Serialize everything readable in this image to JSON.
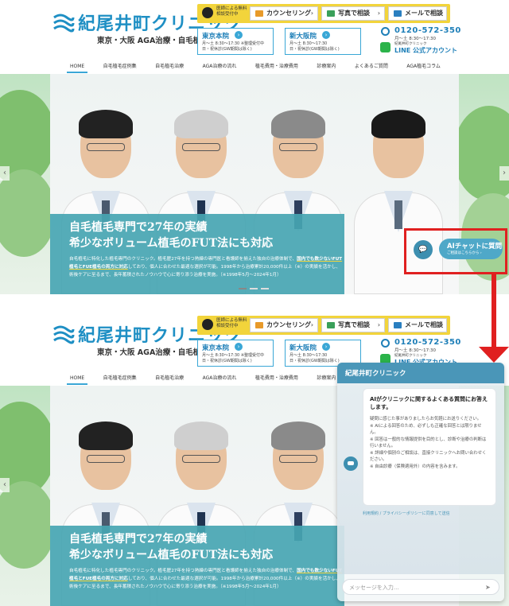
{
  "header": {
    "brand_name": "紀尾井町クリニック",
    "brand_sub": "東京・大阪 AGA治療・自毛植毛",
    "contact_note": "医師による無料相談受付中",
    "buttons": [
      {
        "label": "カウンセリング",
        "color": "#e89a2a"
      },
      {
        "label": "写真で相談",
        "color": "#3aa05a"
      },
      {
        "label": "メールで相談",
        "color": "#2a7fc0"
      }
    ],
    "clinics": [
      {
        "name": "東京本院",
        "hours": "月〜土 8:30〜17:30 ※整理受付中",
        "holiday": "日・祝休診(GW期間は除く)"
      },
      {
        "name": "新大阪院",
        "hours": "月〜土 8:30〜17:30",
        "holiday": "日・祝休診(GW期間は除く)"
      }
    ],
    "tel": "0120-572-350",
    "tel_hours": "月〜土 8:30〜17:30",
    "line_sub": "紀尾井町クリニック",
    "line_label": "LINE 公式アカウント"
  },
  "nav": [
    "HOME",
    "自毛植毛症例集",
    "自毛植毛治療",
    "AGA治療の流れ",
    "植毛費用・治療費用",
    "診療案内",
    "よくあるご質問",
    "AGA植毛コラム"
  ],
  "hero": {
    "title_line1": "自毛植毛専門で27年の実績",
    "title_line2": "希少なボリューム植毛のFUT法にも対応",
    "body_a": "自毛植毛に特化した植毛専門のクリニック。植毛歴27年を持つ熟練の専門医と看護師を揃えた独自の治療体制で、",
    "body_b": "国内でも数少ないFUT植毛とFUE植毛の両方に対応",
    "body_c": "しており、個人に合わせた最適な選択が可能。1998年から治療累計20,000件以上（※）の実績を活かし、術後ケアに至るまで、長年蓄積されたノウハウで心に寄り添う治療を実施。（※1998年5月〜2024年1月）"
  },
  "ai_chat_button": {
    "label": "AIチャットに質問",
    "sub": "ご相談はこちらから ›"
  },
  "chat": {
    "title": "紀尾井町クリニック",
    "message_title": "AIがクリニックに関するよくある質問にお答えします。",
    "message_lines": [
      "疑問に感じた事がありましたらお気軽にお送りください。",
      "※ AIによる回答のため、必ずしも正確な回答とは限りません。",
      "※ 回答は一般的な情報提供を目的とし、診断や治療の判断は行いません。",
      "※ 詳細や個別のご相談は、直接クリニックへお問い合わせください。",
      "※ 自由診療（保険適用外）の内容を含みます。"
    ],
    "link_text": "利用規約 / プライバシーポリシーに同意して送信",
    "input_placeholder": "メッセージを入力..."
  }
}
